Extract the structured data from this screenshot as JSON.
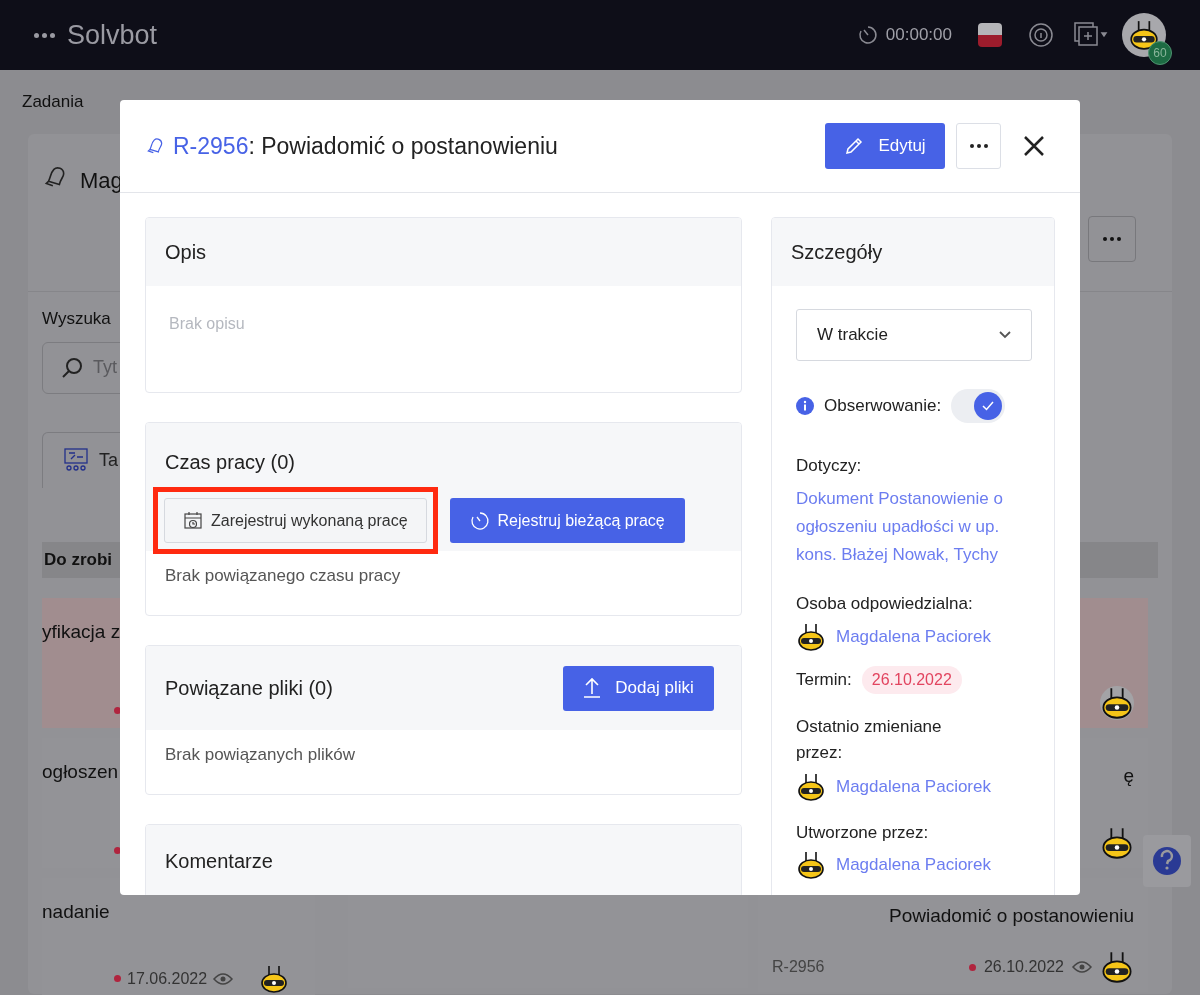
{
  "navbar": {
    "brand": "Solvbot",
    "timer": "00:00:00",
    "user_badge": "60"
  },
  "page": {
    "breadcrumb": "Zadania",
    "board_title": "Mag",
    "search_label": "Wyszuka",
    "search_placeholder": "Tyt",
    "tab_label": "Ta",
    "column_header": "Do zrobi",
    "left_cards": [
      {
        "title": "yfikacja z",
        "overdue": true
      },
      {
        "title": "ogłoszen",
        "overdue": false
      },
      {
        "title": "nadanie",
        "overdue": false,
        "date": "17.06.2022"
      }
    ],
    "right_cards": [
      {
        "overdue": true
      },
      {
        "title": "ę",
        "overdue": false
      },
      {
        "title": "Powiadomić o postanowieniu",
        "id": "R-2956",
        "date": "26.10.2022",
        "overdue": false
      }
    ]
  },
  "modal": {
    "task_id": "R-2956",
    "title": ": Powiadomić o postanowieniu",
    "edit_button": "Edytuj",
    "description": {
      "heading": "Opis",
      "empty_text": "Brak opisu"
    },
    "work_time": {
      "heading": "Czas pracy (0)",
      "buttons": [
        {
          "label": "Zarejestruj wykonaną pracę",
          "kind": "secondary",
          "highlighted": true
        },
        {
          "label": "Rejestruj bieżącą pracę",
          "kind": "primary",
          "highlighted": false
        }
      ],
      "empty_text": "Brak powiązanego czasu pracy"
    },
    "files": {
      "heading": "Powiązane pliki (0)",
      "button": "Dodaj pliki",
      "empty_text": "Brak powiązanych plików"
    },
    "comments": {
      "heading": "Komentarze"
    },
    "details": {
      "heading": "Szczegóły",
      "status": "W trakcie",
      "watch_label": "Obserwowanie:",
      "watching": true,
      "concerns_label": "Dotyczy:",
      "concerns_link": "Dokument Postanowienie o ogłoszeniu upadłości w up. kons. Błażej Nowak, Tychy",
      "responsible_label": "Osoba odpowiedzialna:",
      "responsible": "Magdalena Paciorek",
      "deadline_label": "Termin:",
      "deadline": "26.10.2022",
      "deadline_overdue": true,
      "modified_label": "Ostatnio zmieniane przez:",
      "modified_by": "Magdalena Paciorek",
      "created_label": "Utworzone przez:",
      "created_by": "Magdalena Paciorek"
    }
  }
}
